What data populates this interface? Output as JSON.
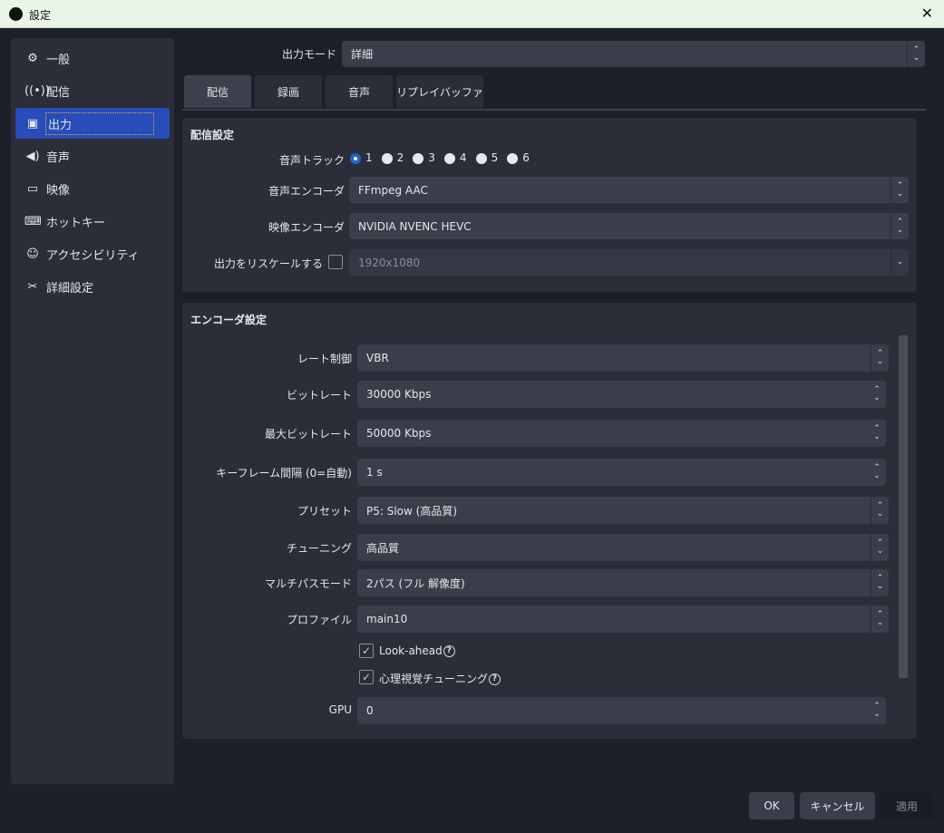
{
  "window": {
    "title": "設定",
    "close": "✕"
  },
  "sidebar": {
    "items": [
      {
        "label": "一般",
        "icon": "⚙"
      },
      {
        "label": "配信",
        "icon": "📶"
      },
      {
        "label": "出力",
        "icon": "▣"
      },
      {
        "label": "音声",
        "icon": "🔊"
      },
      {
        "label": "映像",
        "icon": "▭"
      },
      {
        "label": "ホットキー",
        "icon": "⌨"
      },
      {
        "label": "アクセシビリティ",
        "icon": "☺"
      },
      {
        "label": "詳細設定",
        "icon": "✂"
      }
    ]
  },
  "output_mode": {
    "label": "出力モード",
    "value": "詳細"
  },
  "tabs": [
    "配信",
    "録画",
    "音声",
    "リプレイバッファ"
  ],
  "stream": {
    "title": "配信設定",
    "audio_track_label": "音声トラック",
    "tracks": [
      "1",
      "2",
      "3",
      "4",
      "5",
      "6"
    ],
    "audio_encoder_label": "音声エンコーダ",
    "audio_encoder": "FFmpeg AAC",
    "video_encoder_label": "映像エンコーダ",
    "video_encoder": "NVIDIA NVENC HEVC",
    "rescale_label": "出力をリスケールする",
    "rescale_value": "1920x1080"
  },
  "encoder": {
    "title": "エンコーダ設定",
    "rows": [
      {
        "label": "レート制御",
        "value": "VBR"
      },
      {
        "label": "ビットレート",
        "value": "30000 Kbps"
      },
      {
        "label": "最大ビットレート",
        "value": "50000 Kbps"
      },
      {
        "label": "キーフレーム間隔 (0=自動)",
        "value": "1 s"
      },
      {
        "label": "プリセット",
        "value": "P5: Slow (高品質)"
      },
      {
        "label": "チューニング",
        "value": "高品質"
      },
      {
        "label": "マルチパスモード",
        "value": "2パス (フル 解像度)"
      },
      {
        "label": "プロファイル",
        "value": "main10"
      }
    ],
    "lookahead": "Look-ahead",
    "psycho": "心理視覚チューニング",
    "help": "?",
    "gpu_label": "GPU",
    "gpu": "0"
  },
  "buttons": {
    "ok": "OK",
    "cancel": "キャンセル",
    "apply": "適用"
  }
}
